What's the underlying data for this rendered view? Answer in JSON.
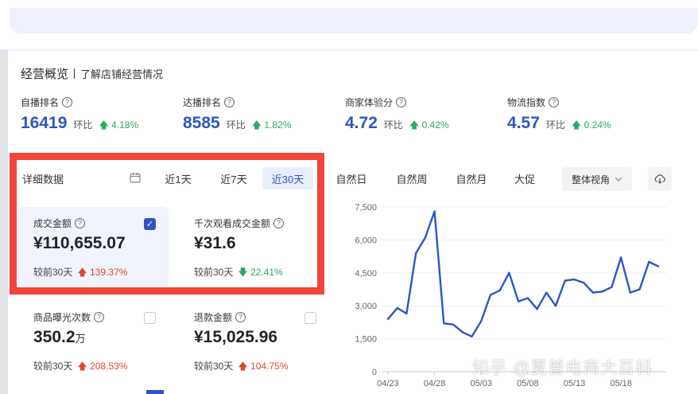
{
  "header": {
    "title": "经营概览",
    "subtitle": "了解店铺经营情况"
  },
  "metrics": [
    {
      "label": "自播排名",
      "value": "16419",
      "cmp_label": "环比",
      "delta": "4.18%"
    },
    {
      "label": "达播排名",
      "value": "8585",
      "cmp_label": "环比",
      "delta": "1.82%"
    },
    {
      "label": "商家体验分",
      "value": "4.72",
      "cmp_label": "环比",
      "delta": "0.42%"
    },
    {
      "label": "物流指数",
      "value": "4.57",
      "cmp_label": "环比",
      "delta": "0.24%"
    }
  ],
  "tabs": {
    "section_label": "详细数据",
    "periods": [
      "近1天",
      "近7天",
      "近30天"
    ],
    "natural": [
      "自然日",
      "自然周",
      "自然月",
      "大促"
    ],
    "dropdown": "整体视角"
  },
  "kpis": [
    {
      "label": "成交金额",
      "value": "¥110,655.07",
      "unit": "",
      "cmp": "较前30天",
      "delta": "139.37%",
      "direction": "up",
      "checked": true
    },
    {
      "label": "千次观看成交金额",
      "value": "¥31.6",
      "unit": "",
      "cmp": "较前30天",
      "delta": "22.41%",
      "direction": "down",
      "checked": false
    },
    {
      "label": "商品曝光次数",
      "value": "350.2",
      "unit": "万",
      "cmp": "较前30天",
      "delta": "208.53%",
      "direction": "up",
      "checked": false
    },
    {
      "label": "退款金额",
      "value": "¥15,025.96",
      "unit": "",
      "cmp": "较前30天",
      "delta": "104.75%",
      "direction": "up",
      "checked": false
    }
  ],
  "watermark": "知乎 @夏普电商大百科",
  "colors": {
    "accent": "#2d55c7",
    "up_red": "#e0462f",
    "down_green": "#2aa865",
    "frame": "#f0453a"
  },
  "chart_data": {
    "type": "line",
    "x_tick_labels": [
      "04/23",
      "04/28",
      "05/03",
      "05/08",
      "05/13",
      "05/18"
    ],
    "y_tick_labels": [
      "0",
      "1,500",
      "3,000",
      "4,500",
      "6,000",
      "7,500"
    ],
    "ylim": [
      0,
      7500
    ],
    "grid": true,
    "series": [
      {
        "values": [
          2400,
          2900,
          2650,
          5400,
          6100,
          7300,
          2200,
          2150,
          1800,
          1600,
          2300,
          3500,
          3700,
          4500,
          3200,
          3350,
          2850,
          3600,
          3000,
          4150,
          4200,
          4050,
          3600,
          3650,
          3850,
          5200,
          3600,
          3750,
          5000,
          4800
        ]
      }
    ]
  }
}
